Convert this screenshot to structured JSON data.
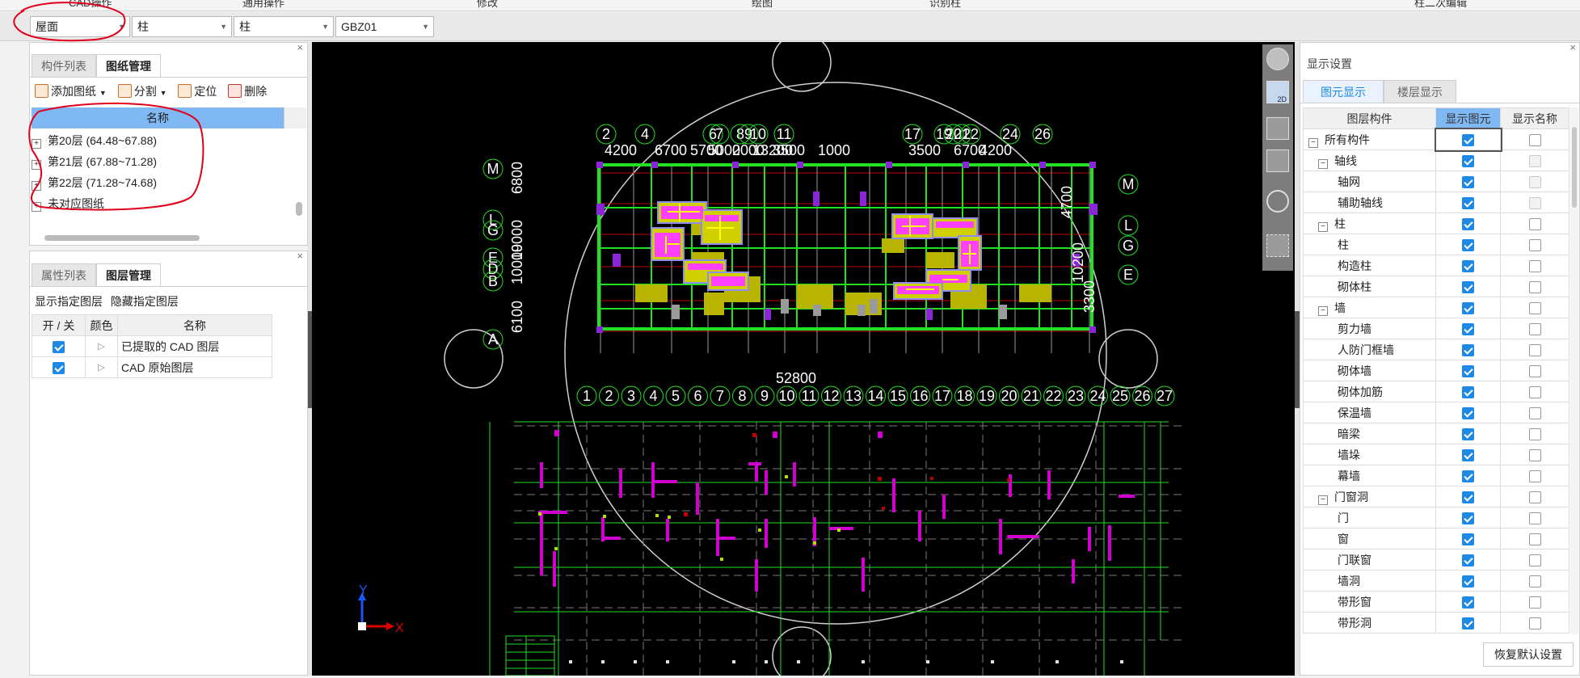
{
  "ribbon": [
    "CAD操作",
    "通用操作",
    "修改",
    "绘图",
    "识别柱",
    "柱二次编辑"
  ],
  "toolbar": {
    "floor": "屋面",
    "category": "柱",
    "type": "柱",
    "component": "GBZ01"
  },
  "drawing_panel": {
    "tabs": [
      "构件列表",
      "图纸管理"
    ],
    "active_tab": "图纸管理",
    "actions": {
      "add": "添加图纸",
      "split": "分割",
      "locate": "定位",
      "delete": "删除"
    },
    "header": "名称",
    "rows": [
      "第20层 (64.48~67.88)",
      "第21层 (67.88~71.28)",
      "第22层 (71.28~74.68)",
      "未对应图纸"
    ]
  },
  "layer_panel": {
    "tabs": [
      "属性列表",
      "图层管理"
    ],
    "active_tab": "图层管理",
    "actions": {
      "show": "显示指定图层",
      "hide": "隐藏指定图层"
    },
    "headers": {
      "toggle": "开 / 关",
      "color": "颜色",
      "name": "名称"
    },
    "rows": [
      {
        "name": "已提取的 CAD 图层",
        "on": true
      },
      {
        "name": "CAD 原始图层",
        "on": true
      }
    ]
  },
  "display_panel": {
    "title": "显示设置",
    "tabs": [
      "图元显示",
      "楼层显示"
    ],
    "active_tab": "图元显示",
    "headers": {
      "component": "图层构件",
      "show": "显示图元",
      "name": "显示名称"
    },
    "rows": [
      {
        "label": "所有构件",
        "group": true,
        "level": 0,
        "show": true,
        "name": false,
        "name_disabled": false
      },
      {
        "label": "轴线",
        "group": true,
        "level": 1,
        "show": true,
        "name": false,
        "name_disabled": true
      },
      {
        "label": "轴网",
        "group": false,
        "level": 2,
        "show": true,
        "name": false,
        "name_disabled": true
      },
      {
        "label": "辅助轴线",
        "group": false,
        "level": 2,
        "show": true,
        "name": false,
        "name_disabled": true
      },
      {
        "label": "柱",
        "group": true,
        "level": 1,
        "show": true,
        "name": false,
        "name_disabled": false
      },
      {
        "label": "柱",
        "group": false,
        "level": 2,
        "show": true,
        "name": false,
        "name_disabled": false
      },
      {
        "label": "构造柱",
        "group": false,
        "level": 2,
        "show": true,
        "name": false,
        "name_disabled": false
      },
      {
        "label": "砌体柱",
        "group": false,
        "level": 2,
        "show": true,
        "name": false,
        "name_disabled": false
      },
      {
        "label": "墙",
        "group": true,
        "level": 1,
        "show": true,
        "name": false,
        "name_disabled": false
      },
      {
        "label": "剪力墙",
        "group": false,
        "level": 2,
        "show": true,
        "name": false,
        "name_disabled": false
      },
      {
        "label": "人防门框墙",
        "group": false,
        "level": 2,
        "show": true,
        "name": false,
        "name_disabled": false
      },
      {
        "label": "砌体墙",
        "group": false,
        "level": 2,
        "show": true,
        "name": false,
        "name_disabled": false
      },
      {
        "label": "砌体加筋",
        "group": false,
        "level": 2,
        "show": true,
        "name": false,
        "name_disabled": false
      },
      {
        "label": "保温墙",
        "group": false,
        "level": 2,
        "show": true,
        "name": false,
        "name_disabled": false
      },
      {
        "label": "暗梁",
        "group": false,
        "level": 2,
        "show": true,
        "name": false,
        "name_disabled": false
      },
      {
        "label": "墙垛",
        "group": false,
        "level": 2,
        "show": true,
        "name": false,
        "name_disabled": false
      },
      {
        "label": "幕墙",
        "group": false,
        "level": 2,
        "show": true,
        "name": false,
        "name_disabled": false
      },
      {
        "label": "门窗洞",
        "group": true,
        "level": 1,
        "show": true,
        "name": false,
        "name_disabled": false
      },
      {
        "label": "门",
        "group": false,
        "level": 2,
        "show": true,
        "name": false,
        "name_disabled": false
      },
      {
        "label": "窗",
        "group": false,
        "level": 2,
        "show": true,
        "name": false,
        "name_disabled": false
      },
      {
        "label": "门联窗",
        "group": false,
        "level": 2,
        "show": true,
        "name": false,
        "name_disabled": false
      },
      {
        "label": "墙洞",
        "group": false,
        "level": 2,
        "show": true,
        "name": false,
        "name_disabled": false
      },
      {
        "label": "带形窗",
        "group": false,
        "level": 2,
        "show": true,
        "name": false,
        "name_disabled": false
      },
      {
        "label": "带形洞",
        "group": false,
        "level": 2,
        "show": true,
        "name": false,
        "name_disabled": false
      }
    ],
    "restore": "恢复默认设置"
  },
  "cad": {
    "top_axes": [
      "2",
      "4",
      "6",
      "7",
      "8",
      "9",
      "10",
      "11",
      "17",
      "19",
      "20",
      "21",
      "22",
      "24",
      "26"
    ],
    "top_dims": [
      "4200",
      "6700",
      "5700",
      "5000",
      "2000",
      "13200",
      "3500",
      "1000",
      "3500",
      "6700",
      "4200"
    ],
    "bottom_axes": [
      "1",
      "2",
      "3",
      "4",
      "5",
      "6",
      "7",
      "8",
      "9",
      "10",
      "11",
      "12",
      "13",
      "14",
      "15",
      "16",
      "17",
      "18",
      "19",
      "20",
      "21",
      "22",
      "23",
      "24",
      "25",
      "26",
      "27"
    ],
    "bottom_dim_total": "52800",
    "left_axes": [
      "M",
      "L",
      "G",
      "E",
      "D",
      "B",
      "A"
    ],
    "right_axes": [
      "M",
      "L",
      "G",
      "E"
    ],
    "left_dims": [
      "6800",
      "19000",
      "10000",
      "6100"
    ],
    "right_dims": [
      "4700",
      "10200",
      "3300"
    ],
    "ucs": {
      "x": "X",
      "y": "Y"
    },
    "view_label": "2D"
  },
  "colors": {
    "accent": "#1e88e5",
    "canvas": "#000000",
    "header_blue": "#7fb8f3",
    "annotation": "#e0001b"
  }
}
